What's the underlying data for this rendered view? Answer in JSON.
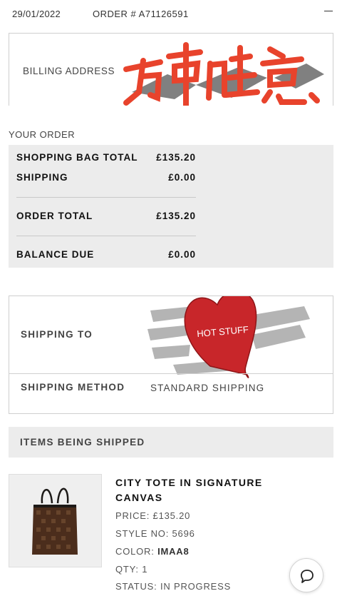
{
  "header": {
    "date": "29/01/2022",
    "order_number": "ORDER # A71126591",
    "collapse_icon": "minus-icon"
  },
  "billing": {
    "label": "BILLING ADDRESS",
    "sticker_icon": "chinese-calligraphy-sticker",
    "sticker_colors": [
      "#e8432c",
      "#555555"
    ]
  },
  "your_order": {
    "heading": "YOUR ORDER",
    "rows": [
      {
        "label": "SHOPPING BAG TOTAL",
        "value": "£135.20"
      },
      {
        "label": "SHIPPING",
        "value": "£0.00"
      },
      {
        "label": "ORDER TOTAL",
        "value": "£135.20"
      },
      {
        "label": "BALANCE DUE",
        "value": "£0.00"
      }
    ]
  },
  "shipping": {
    "to_label": "SHIPPING TO",
    "sticker_text": "HOT STUFF",
    "sticker_icon": "heart-sticker",
    "sticker_color": "#c8262a",
    "method_label": "SHIPPING METHOD",
    "method_value": "STANDARD SHIPPING"
  },
  "items": {
    "heading": "ITEMS BEING SHIPPED",
    "product": {
      "image_icon": "tote-bag-image",
      "name": "CITY TOTE IN SIGNATURE CANVAS",
      "price_label": "PRICE: £135.20",
      "style_label": "STYLE NO: 5696",
      "color_prefix": "COLOR: ",
      "color_value": "IMAA8",
      "qty_label": "QTY: 1",
      "status_label": "STATUS: IN PROGRESS"
    }
  },
  "chat": {
    "icon": "chat-bubble-icon"
  }
}
